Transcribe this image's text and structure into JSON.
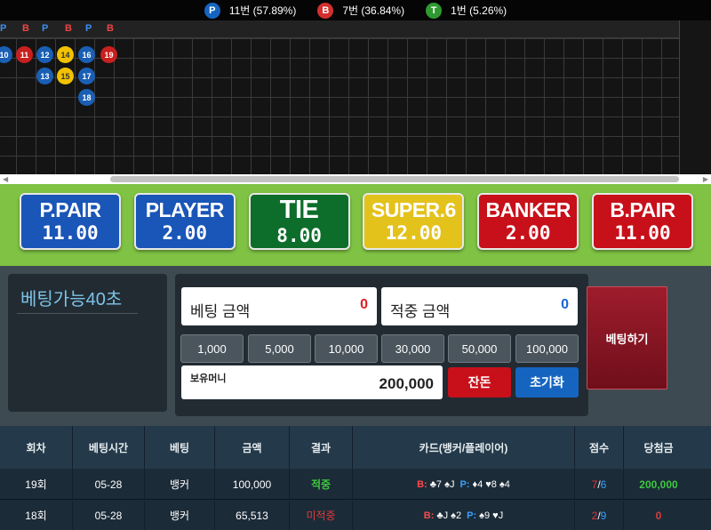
{
  "stats": {
    "player": {
      "icon": "P",
      "text": "11번 (57.89%)"
    },
    "banker": {
      "icon": "B",
      "text": "7번 (36.84%)"
    },
    "tie": {
      "icon": "T",
      "text": "1번 (5.26%)"
    }
  },
  "road": {
    "header_letters": [
      "P",
      "B",
      "P",
      "B",
      "P",
      "B"
    ],
    "beads": [
      {
        "label": "10",
        "result": "P"
      },
      {
        "label": "11",
        "result": "B"
      },
      {
        "label": "12",
        "result": "P"
      },
      {
        "label": "14",
        "result": "T"
      },
      {
        "label": "16",
        "result": "P"
      },
      {
        "label": "19",
        "result": "B"
      },
      {
        "label": "13",
        "result": "P"
      },
      {
        "label": "15",
        "result": "T"
      },
      {
        "label": "17",
        "result": "P"
      },
      {
        "label": "18",
        "result": "P"
      }
    ]
  },
  "bets": [
    {
      "name": "P.PAIR",
      "odds": "11.00",
      "color": "#1a55b8"
    },
    {
      "name": "PLAYER",
      "odds": "2.00",
      "color": "#1a55b8"
    },
    {
      "name": "TIE",
      "odds": "8.00",
      "color": "#0d6e2b"
    },
    {
      "name": "SUPER.6",
      "odds": "12.00",
      "color": "#e4c21c"
    },
    {
      "name": "BANKER",
      "odds": "2.00",
      "color": "#c8101a"
    },
    {
      "name": "B.PAIR",
      "odds": "11.00",
      "color": "#c8101a"
    }
  ],
  "control": {
    "timer": "베팅가능40초",
    "bet_amount_label": "베팅 금액",
    "bet_amount_value": "0",
    "hit_amount_label": "적중 금액",
    "hit_amount_value": "0",
    "chips": [
      "1,000",
      "5,000",
      "10,000",
      "30,000",
      "50,000",
      "100,000"
    ],
    "money_label": "보유머니",
    "money_value": "200,000",
    "change_label": "잔돈",
    "reset_label": "초기화",
    "bet_button": "베팅하기"
  },
  "history": {
    "headers": [
      "회차",
      "베팅시간",
      "베팅",
      "금액",
      "결과",
      "카드(뱅커/플레이어)",
      "점수",
      "당첨금"
    ],
    "rows": [
      {
        "round": "19회",
        "time": "05-28",
        "bet": "뱅커",
        "amount": "100,000",
        "result": "적중",
        "banker_label": "B:",
        "banker_cards": "♣7 ♠J",
        "player_label": "P:",
        "player_cards": "♦4 ♥8 ♠4",
        "score_b": "7",
        "sep": "/",
        "score_p": "6",
        "win": "200,000"
      },
      {
        "round": "18회",
        "time": "05-28",
        "bet": "뱅커",
        "amount": "65,513",
        "result": "미적중",
        "banker_label": "B:",
        "banker_cards": "♣J ♠2",
        "player_label": "P:",
        "player_cards": "♠9 ♥J",
        "score_b": "2",
        "sep": "/",
        "score_p": "9",
        "win": "0"
      }
    ]
  }
}
